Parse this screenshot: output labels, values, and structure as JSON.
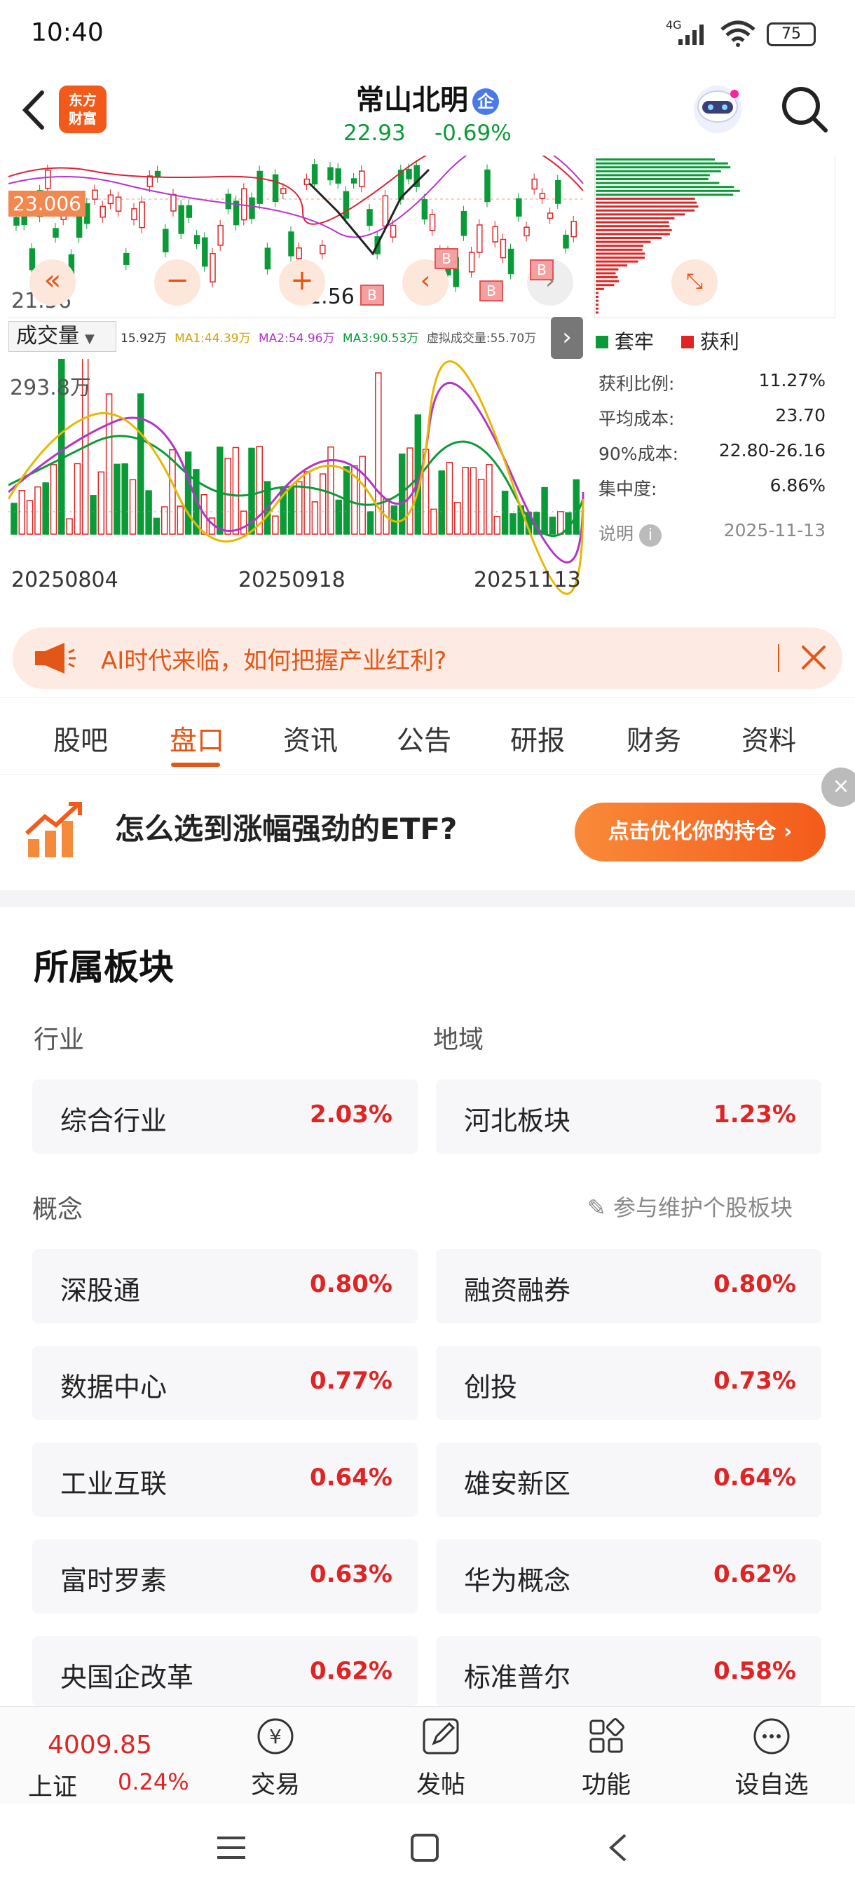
{
  "status_bar": {
    "time": "10:40",
    "network": "4G",
    "battery": "75"
  },
  "header": {
    "back_icon": "chevron-left-icon",
    "logo_line1": "东方",
    "logo_line2": "财富",
    "stock_name": "常山北明",
    "badge": "企",
    "price": "22.93",
    "change": "-0.69%"
  },
  "kline": {
    "price_label_top": "23.006",
    "price_label_low": "21.56",
    "price_label_low2": "21.56",
    "buy_marker": "B"
  },
  "volume_toolbar": {
    "selector": "成交量",
    "vol": "15.92万",
    "ma1": "MA1:44.39万",
    "ma2": "MA2:54.96万",
    "ma3": "MA3:90.53万",
    "virtual": "虚拟成交量:55.70万"
  },
  "volume_chart": {
    "max_label": "293.8万",
    "dates": [
      "20250804",
      "20250918",
      "20251113"
    ]
  },
  "chip_panel": {
    "legend_trapped": "套牢",
    "legend_profit": "获利",
    "rows": [
      {
        "label": "获利比例:",
        "value": "11.27%"
      },
      {
        "label": "平均成本:",
        "value": "23.70"
      },
      {
        "label": "90%成本:",
        "value": "22.80-26.16"
      },
      {
        "label": "集中度:",
        "value": "6.86%"
      }
    ],
    "note_label": "说明",
    "note_date": "2025-11-13"
  },
  "ad_banner": {
    "text": "AI时代来临，如何把握产业红利?"
  },
  "tabs": [
    "股吧",
    "盘口",
    "资讯",
    "公告",
    "研报",
    "财务",
    "资料"
  ],
  "active_tab": "盘口",
  "promo": {
    "text": "怎么选到涨幅强劲的ETF?",
    "button": "点击优化你的持仓 ›"
  },
  "sectors": {
    "title": "所属板块",
    "industry_label": "行业",
    "region_label": "地域",
    "industry": {
      "name": "综合行业",
      "pct": "2.03%"
    },
    "region": {
      "name": "河北板块",
      "pct": "1.23%"
    },
    "concept_label": "概念",
    "maintain_link": "参与维护个股板块",
    "concepts": [
      {
        "name": "深股通",
        "pct": "0.80%"
      },
      {
        "name": "融资融券",
        "pct": "0.80%"
      },
      {
        "name": "数据中心",
        "pct": "0.77%"
      },
      {
        "name": "创投",
        "pct": "0.73%"
      },
      {
        "name": "工业互联",
        "pct": "0.64%"
      },
      {
        "name": "雄安新区",
        "pct": "0.64%"
      },
      {
        "name": "富时罗素",
        "pct": "0.63%"
      },
      {
        "name": "华为概念",
        "pct": "0.62%"
      },
      {
        "name": "央国企改革",
        "pct": "0.62%"
      },
      {
        "name": "标准普尔",
        "pct": "0.58%"
      }
    ]
  },
  "bottom_bar": {
    "index_value": "4009.85",
    "index_name": "上证",
    "index_change": "0.24%",
    "items": [
      "交易",
      "发帖",
      "功能",
      "设自选"
    ]
  },
  "colors": {
    "accent": "#e25617",
    "up": "#e02424",
    "down": "#0a9b38"
  }
}
